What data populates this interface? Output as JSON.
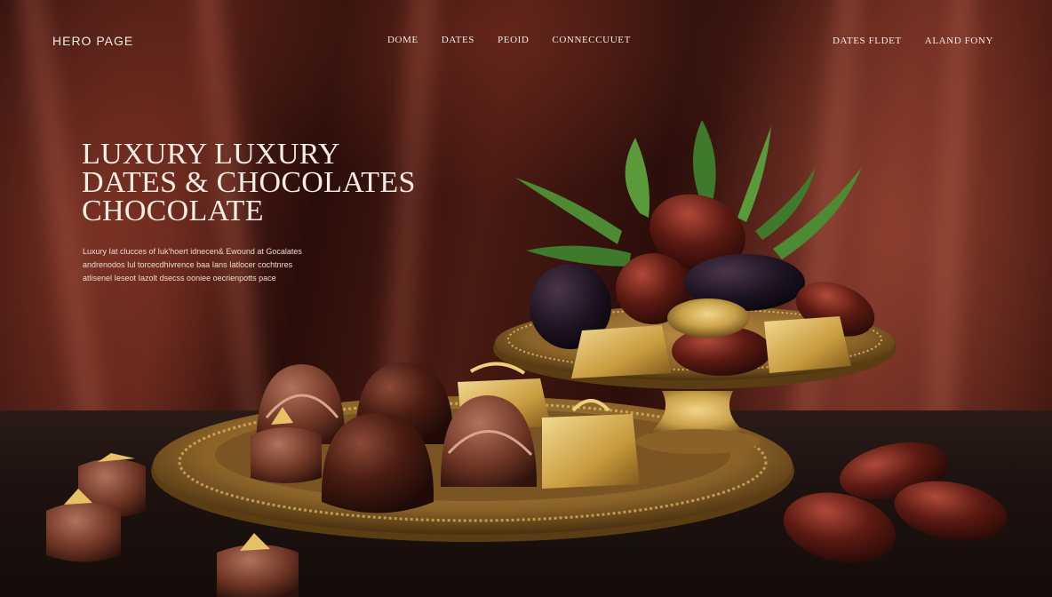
{
  "nav": {
    "brand": "HERO PAGE",
    "items": [
      {
        "label": "DOME"
      },
      {
        "label": "DATES"
      },
      {
        "label": "PEOID"
      },
      {
        "label": "CONNECCUUET"
      }
    ],
    "right_items": [
      {
        "label": "DATES FLDET"
      },
      {
        "label": "ALAND FONY"
      }
    ]
  },
  "hero": {
    "title_lines": [
      "LUXURY LUXURY",
      "DATES & CHOCOLATES",
      "CHOCOLATE"
    ],
    "copy_lines": [
      "Luxury Iat clucces of Iuk'hoert idnecen& Ewound at Gocalates",
      "andrenodos Iul torcecdhivrence baa Ians Iatlocer cochtnres",
      "atlisenel Ieseot Iazolt dsecss ooniee oecrienpotts pace"
    ]
  },
  "colors": {
    "background": "#1a0b08",
    "drape": "#5a2219",
    "gold": "#c9a24a",
    "chocolate": "#3d1810",
    "text": "#f5ece4"
  }
}
